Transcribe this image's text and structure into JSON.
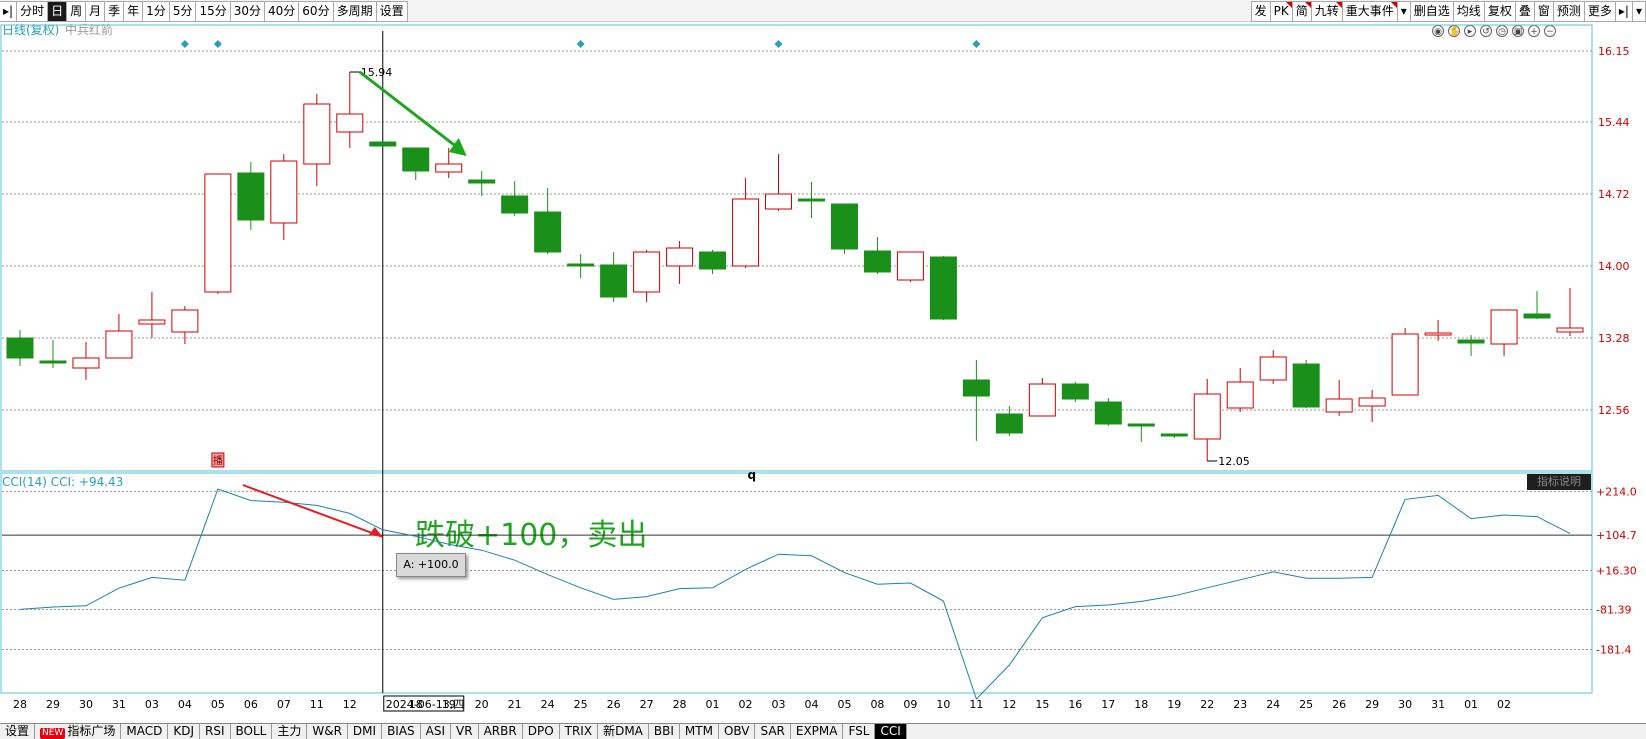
{
  "toolbar": {
    "left": [
      {
        "label": "▸|",
        "icon": "jump-start-icon"
      },
      {
        "label": "分时"
      },
      {
        "label": "日",
        "active": true
      },
      {
        "label": "周"
      },
      {
        "label": "月"
      },
      {
        "label": "季"
      },
      {
        "label": "年"
      },
      {
        "label": "1分"
      },
      {
        "label": "5分"
      },
      {
        "label": "15分"
      },
      {
        "label": "30分"
      },
      {
        "label": "40分"
      },
      {
        "label": "60分"
      },
      {
        "label": "多周期"
      },
      {
        "label": "设置"
      }
    ],
    "right": [
      {
        "label": "发"
      },
      {
        "label": "PK",
        "flag": true
      },
      {
        "label": "简",
        "flag": true
      },
      {
        "label": "九转",
        "flag": true
      },
      {
        "label": "重大事件",
        "flag": true
      },
      {
        "label": "▾"
      },
      {
        "label": "删自选"
      },
      {
        "label": "均线"
      },
      {
        "label": "复权"
      },
      {
        "label": "叠"
      },
      {
        "label": "窗"
      },
      {
        "label": "预测"
      },
      {
        "label": "更多"
      },
      {
        "label": "▸|"
      },
      {
        "label": "▾"
      }
    ]
  },
  "header": {
    "title": "日线(复权)",
    "subtitle": "中兵红箭"
  },
  "chart_data": [
    {
      "type": "candlestick",
      "name": "中兵红箭 日线(复权)",
      "y_ticks": [
        "16.15",
        "15.44",
        "14.72",
        "14.00",
        "13.28",
        "12.56"
      ],
      "ylim": [
        11.95,
        16.25
      ],
      "colors": {
        "up": "#d20000",
        "down": "#1a8f1a"
      },
      "candles": [
        {
          "d": "28",
          "o": 13.28,
          "h": 13.36,
          "l": 13.0,
          "c": 13.08
        },
        {
          "d": "29",
          "o": 13.05,
          "h": 13.26,
          "l": 12.98,
          "c": 13.04
        },
        {
          "d": "30",
          "o": 12.98,
          "h": 13.24,
          "l": 12.86,
          "c": 13.08
        },
        {
          "d": "31",
          "o": 13.08,
          "h": 13.52,
          "l": 13.08,
          "c": 13.35
        },
        {
          "d": "03",
          "o": 13.42,
          "h": 13.74,
          "l": 13.28,
          "c": 13.46
        },
        {
          "d": "04",
          "o": 13.34,
          "h": 13.6,
          "l": 13.22,
          "c": 13.56
        },
        {
          "d": "05",
          "o": 13.74,
          "h": 14.92,
          "l": 13.72,
          "c": 14.92
        },
        {
          "d": "06",
          "o": 14.93,
          "h": 15.04,
          "l": 14.36,
          "c": 14.46
        },
        {
          "d": "07",
          "o": 14.43,
          "h": 15.12,
          "l": 14.26,
          "c": 15.05
        },
        {
          "d": "11",
          "o": 15.02,
          "h": 15.72,
          "l": 14.8,
          "c": 15.62
        },
        {
          "d": "12",
          "o": 15.34,
          "h": 15.94,
          "l": 15.18,
          "c": 15.52
        },
        {
          "d": "13",
          "o": 15.24,
          "h": 15.24,
          "l": 15.2,
          "c": 15.2
        },
        {
          "d": "14",
          "o": 15.18,
          "h": 15.18,
          "l": 14.86,
          "c": 14.95
        },
        {
          "d": "17",
          "o": 14.94,
          "h": 15.18,
          "l": 14.88,
          "c": 15.02
        },
        {
          "d": "18",
          "o": 14.86,
          "h": 14.95,
          "l": 14.7,
          "c": 14.83
        },
        {
          "d": "19",
          "o": 14.7,
          "h": 14.85,
          "l": 14.5,
          "c": 14.53
        },
        {
          "d": "20",
          "o": 14.54,
          "h": 14.78,
          "l": 14.12,
          "c": 14.14
        },
        {
          "d": "21",
          "o": 14.02,
          "h": 14.12,
          "l": 13.88,
          "c": 14.01
        },
        {
          "d": "24",
          "o": 14.01,
          "h": 14.14,
          "l": 13.64,
          "c": 13.69
        },
        {
          "d": "25",
          "o": 13.74,
          "h": 14.16,
          "l": 13.64,
          "c": 14.14
        },
        {
          "d": "26",
          "o": 14.0,
          "h": 14.25,
          "l": 13.82,
          "c": 14.18
        },
        {
          "d": "27",
          "o": 14.14,
          "h": 14.16,
          "l": 13.92,
          "c": 13.97
        },
        {
          "d": "28",
          "o": 14.0,
          "h": 14.88,
          "l": 13.98,
          "c": 14.67
        },
        {
          "d": "01",
          "o": 14.57,
          "h": 15.12,
          "l": 14.55,
          "c": 14.72
        },
        {
          "d": "02",
          "o": 14.67,
          "h": 14.84,
          "l": 14.48,
          "c": 14.65
        },
        {
          "d": "03",
          "o": 14.62,
          "h": 14.62,
          "l": 14.12,
          "c": 14.17
        },
        {
          "d": "04",
          "o": 14.15,
          "h": 14.29,
          "l": 13.92,
          "c": 13.94
        },
        {
          "d": "05",
          "o": 13.86,
          "h": 14.14,
          "l": 13.84,
          "c": 14.14
        },
        {
          "d": "08",
          "o": 14.09,
          "h": 14.1,
          "l": 13.46,
          "c": 13.47
        },
        {
          "d": "09",
          "o": 12.86,
          "h": 13.06,
          "l": 12.25,
          "c": 12.7
        },
        {
          "d": "10",
          "o": 12.52,
          "h": 12.6,
          "l": 12.3,
          "c": 12.33
        },
        {
          "d": "11",
          "o": 12.5,
          "h": 12.88,
          "l": 12.5,
          "c": 12.82
        },
        {
          "d": "12",
          "o": 12.82,
          "h": 12.84,
          "l": 12.64,
          "c": 12.67
        },
        {
          "d": "15",
          "o": 12.64,
          "h": 12.68,
          "l": 12.4,
          "c": 12.42
        },
        {
          "d": "16",
          "o": 12.42,
          "h": 12.42,
          "l": 12.24,
          "c": 12.41
        },
        {
          "d": "17",
          "o": 12.32,
          "h": 12.32,
          "l": 12.28,
          "c": 12.3
        },
        {
          "d": "18",
          "o": 12.27,
          "h": 12.87,
          "l": 12.05,
          "c": 12.72
        },
        {
          "d": "19",
          "o": 12.58,
          "h": 12.98,
          "l": 12.54,
          "c": 12.84
        },
        {
          "d": "22",
          "o": 12.86,
          "h": 13.16,
          "l": 12.82,
          "c": 13.09
        },
        {
          "d": "23",
          "o": 13.02,
          "h": 13.06,
          "l": 12.58,
          "c": 12.59
        },
        {
          "d": "24",
          "o": 12.54,
          "h": 12.86,
          "l": 12.5,
          "c": 12.67
        },
        {
          "d": "25",
          "o": 12.6,
          "h": 12.76,
          "l": 12.44,
          "c": 12.68
        },
        {
          "d": "26",
          "o": 12.71,
          "h": 13.38,
          "l": 12.71,
          "c": 13.32
        },
        {
          "d": "29",
          "o": 13.32,
          "h": 13.46,
          "l": 13.25,
          "c": 13.33
        },
        {
          "d": "30",
          "o": 13.26,
          "h": 13.31,
          "l": 13.1,
          "c": 13.23
        },
        {
          "d": "31",
          "o": 13.22,
          "h": 13.56,
          "l": 13.1,
          "c": 13.56
        },
        {
          "d": "01",
          "o": 13.52,
          "h": 13.75,
          "l": 13.47,
          "c": 13.48
        },
        {
          "d": "02",
          "o": 13.34,
          "h": 13.78,
          "l": 13.3,
          "c": 13.38
        }
      ],
      "annotations": [
        {
          "label": "15.94",
          "candle": 10
        },
        {
          "label": "12.05",
          "candle": 36
        }
      ],
      "marker_q": "q",
      "marker_box": "播"
    },
    {
      "type": "line",
      "title": "CCI(14) CCI: +94.43",
      "y_ticks": [
        "+214.0",
        "+104.7",
        "+16.30",
        "-81.39",
        "-181.4"
      ],
      "ylim": [
        -290,
        260
      ],
      "series": [
        {
          "values": [
            -81,
            -75,
            -72,
            -28,
            -1,
            -8,
            220,
            191,
            187,
            179,
            159,
            118,
            102,
            82,
            67,
            42,
            6,
            -27,
            -56,
            -49,
            -29,
            -27,
            19,
            57,
            53,
            11,
            -18,
            -15,
            -60,
            -305,
            -220,
            -102,
            -74,
            -70,
            -61,
            -47,
            -27,
            -7,
            13,
            -3,
            -3,
            -1,
            194,
            204,
            146,
            155,
            151,
            109
          ]
        }
      ],
      "x_labels": [
        "28",
        "29",
        "30",
        "31",
        "03",
        "04",
        "05",
        "06",
        "07",
        "11",
        "12",
        "2024-06-13,四",
        "18",
        "19",
        "20",
        "21",
        "24",
        "25",
        "26",
        "27",
        "28",
        "01",
        "02",
        "03",
        "04",
        "05",
        "08",
        "09",
        "10",
        "11",
        "12",
        "15",
        "16",
        "17",
        "18",
        "19",
        "22",
        "23",
        "24",
        "25",
        "26",
        "29",
        "30",
        "31",
        "01",
        "02"
      ],
      "annotation": "跌破+100，卖出",
      "tooltip": "A: +100.0",
      "legend_button": "指标说明"
    }
  ],
  "bottom_tabs": [
    {
      "label": "设置"
    },
    {
      "label": "指标广场",
      "badge": "NEW"
    },
    {
      "label": "MACD"
    },
    {
      "label": "KDJ"
    },
    {
      "label": "RSI"
    },
    {
      "label": "BOLL"
    },
    {
      "label": "主力"
    },
    {
      "label": "W&R"
    },
    {
      "label": "DMI"
    },
    {
      "label": "BIAS"
    },
    {
      "label": "ASI"
    },
    {
      "label": "VR"
    },
    {
      "label": "ARBR"
    },
    {
      "label": "DPO"
    },
    {
      "label": "TRIX"
    },
    {
      "label": "新DMA"
    },
    {
      "label": "BBI"
    },
    {
      "label": "MTM"
    },
    {
      "label": "OBV"
    },
    {
      "label": "SAR"
    },
    {
      "label": "EXPMA"
    },
    {
      "label": "FSL"
    },
    {
      "label": "CCI",
      "active": true
    }
  ]
}
